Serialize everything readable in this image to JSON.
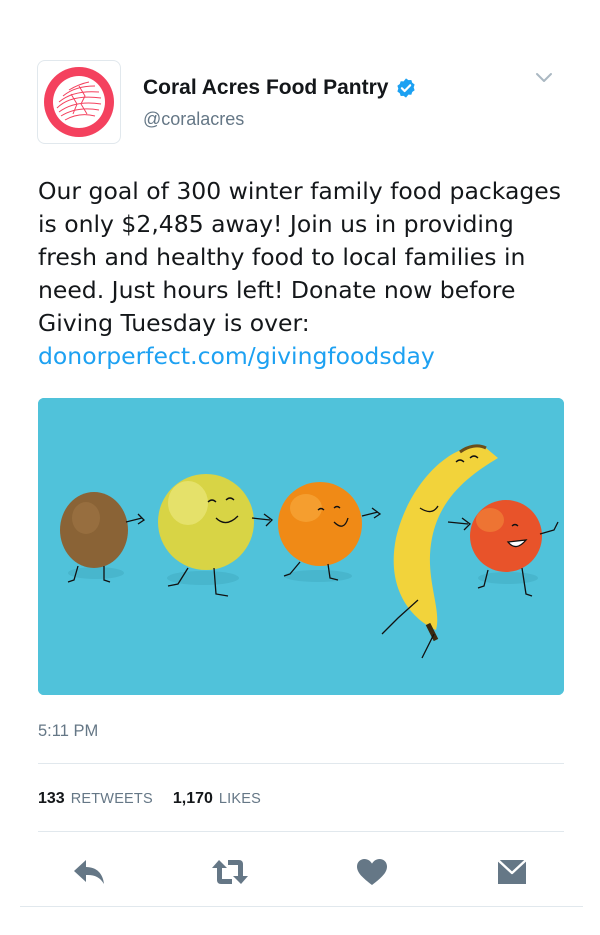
{
  "account": {
    "display_name": "Coral Acres Food Pantry",
    "handle": "@coralacres",
    "verified": true,
    "avatar": "coral-ring-logo",
    "accent_color": "#f4415e",
    "verified_color": "#1da1f2"
  },
  "tweet": {
    "text": "Our goal of 300 winter family food packages is only $2,485 away! Join us in providing fresh and healthy food to local families in need. Just hours left! Donate now before Giving Tuesday is over: ",
    "link_text": "donorperfect.com/givingfoodsday",
    "link_color": "#1da1f2",
    "timestamp": "5:11 PM",
    "media": {
      "type": "photo",
      "background": "#50c2da",
      "subjects": [
        "kiwi",
        "apple",
        "orange",
        "banana",
        "peach"
      ]
    }
  },
  "stats": {
    "retweets_count": "133",
    "retweets_label": "RETWEETS",
    "likes_count": "1,170",
    "likes_label": "LIKES"
  },
  "actions": {
    "icons": [
      "reply-icon",
      "retweet-icon",
      "like-icon",
      "direct-message-icon"
    ],
    "icon_color": "#657786"
  }
}
